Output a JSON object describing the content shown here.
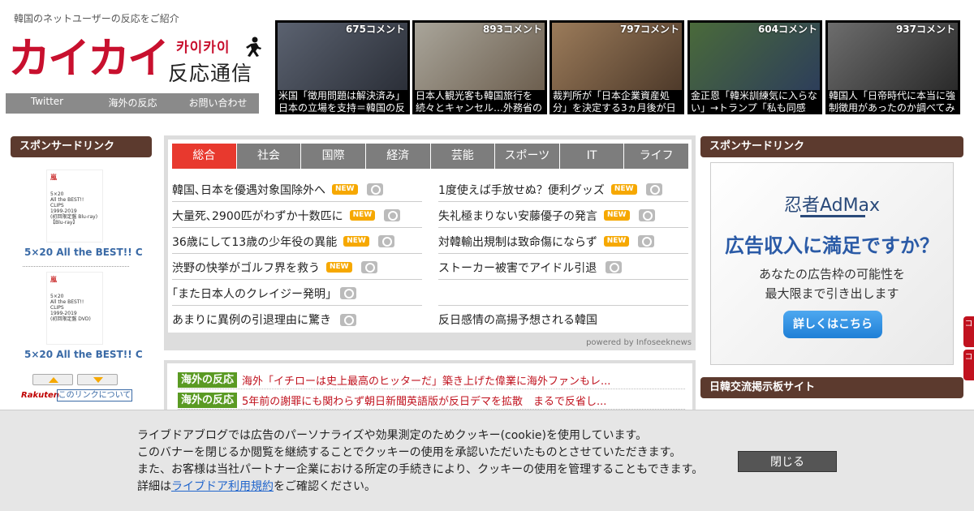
{
  "header": {
    "tagline": "韓国のネットユーザーの反応をご紹介",
    "logo_main": "カイカイ",
    "logo_hangul": "카이카이",
    "logo_sub": "反応通信",
    "nav": [
      "Twitter",
      "海外の反応",
      "お問い合わせ"
    ]
  },
  "top_news": [
    {
      "comments": "675コメント",
      "title": "米国「徴用問題は解決済み」日本の立場を支持＝韓国の反",
      "colors": [
        "#5b6270",
        "#2b2f38"
      ]
    },
    {
      "comments": "893コメント",
      "title": "日本人観光客も韓国旅行を続々とキャンセル…外務省の",
      "colors": [
        "#a9a59a",
        "#6d5f4f"
      ]
    },
    {
      "comments": "797コメント",
      "title": "裁判所が「日本企業資産処分」を決定する3ヵ月後が日",
      "colors": [
        "#9b7b5a",
        "#4e3a2a"
      ]
    },
    {
      "comments": "604コメント",
      "title": "金正恩「韓米訓練気に入らない」→トランプ「私も同感",
      "colors": [
        "#4a6a3a",
        "#2d3e5a"
      ]
    },
    {
      "comments": "937コメント",
      "title": "韓国人「日帝時代に本当に強制徴用があったのか調べてみ",
      "colors": [
        "#6d6d6d",
        "#2a2a2a"
      ]
    }
  ],
  "left_sidebar": {
    "heading": "スポンサードリンク",
    "products": [
      {
        "brand": "嵐",
        "lines": [
          "5×20",
          "All the BEST!!",
          "CLIPS",
          "1999-2019",
          "(初回限定盤 Blu-ray)",
          "【Blu-ray】"
        ],
        "title": "5×20 All the BEST!! C"
      },
      {
        "brand": "嵐",
        "lines": [
          "5×20",
          "All the BEST!!",
          "CLIPS",
          "1999-2019",
          "(初回限定盤 DVD)"
        ],
        "title": "5×20 All the BEST!! C"
      }
    ],
    "rakuten": "Rakuten",
    "about_link": "このリンクについて"
  },
  "news": {
    "tabs": [
      "総合",
      "社会",
      "国際",
      "経済",
      "芸能",
      "スポーツ",
      "IT",
      "ライフ"
    ],
    "active_tab": 0,
    "new_label": "NEW",
    "left": [
      {
        "title": "韓国､日本を優遇対象国除外へ",
        "new": true,
        "photo": true
      },
      {
        "title": "大量死､2900匹がわずか十数匹に",
        "new": true,
        "photo": true
      },
      {
        "title": "36歳にして13歳の少年役の異能",
        "new": true,
        "photo": true
      },
      {
        "title": "渋野の快挙がゴルフ界を救う",
        "new": true,
        "photo": true
      },
      {
        "title": "｢また日本人のクレイジー発明｣",
        "new": false,
        "photo": true
      },
      {
        "title": "あまりに異例の引退理由に驚き",
        "new": false,
        "photo": true
      }
    ],
    "right": [
      {
        "title": "1度使えば手放せぬ？便利グッズ",
        "new": true,
        "photo": true
      },
      {
        "title": "失礼極まりない安藤優子の発言",
        "new": true,
        "photo": true
      },
      {
        "title": "対韓輸出規制は致命傷にならず",
        "new": true,
        "photo": true
      },
      {
        "title": "ストーカー被害でアイドル引退",
        "new": false,
        "photo": true
      },
      {
        "title": "",
        "new": false,
        "photo": false
      },
      {
        "title": "反日感情の高揚予想される韓国",
        "new": false,
        "photo": false
      }
    ],
    "powered": "powered by Infoseeknews"
  },
  "kaigai": [
    {
      "tag": "海外の反応",
      "title": "海外「イチローは史上最高のヒッターだ」築き上げた偉業に海外ファンもレ..."
    },
    {
      "tag": "海外の反応",
      "title": "5年前の謝罪にも関わらず朝日新聞英語版が反日デマを拡散　まるで反省し..."
    }
  ],
  "right_sidebar": {
    "sponsor_heading": "スポンサードリンク",
    "ad": {
      "brand": "忍者AdMax",
      "headline": "広告収入に満足ですか？",
      "body1": "あなたの広告枠の可能性を",
      "body2": "最大限まで引き出します",
      "button": "詳しくはこちら"
    },
    "board_heading": "日韓交流掲示板サイト",
    "side_tabs": [
      "コ",
      "コ"
    ]
  },
  "cookie": {
    "line1": "ライブドアブログでは広告のパーソナライズや効果測定のためクッキー(cookie)を使用しています。",
    "line2": "このバナーを閉じるか閲覧を継続することでクッキーの使用を承認いただいたものとさせていただきます。",
    "line3": "また、お客様は当社パートナー企業における所定の手続きにより、クッキーの使用を管理することもできます。",
    "line4_prefix": "詳細は",
    "link": "ライブドア利用規約",
    "line4_suffix": "をご確認ください。",
    "close": "閉じる"
  }
}
